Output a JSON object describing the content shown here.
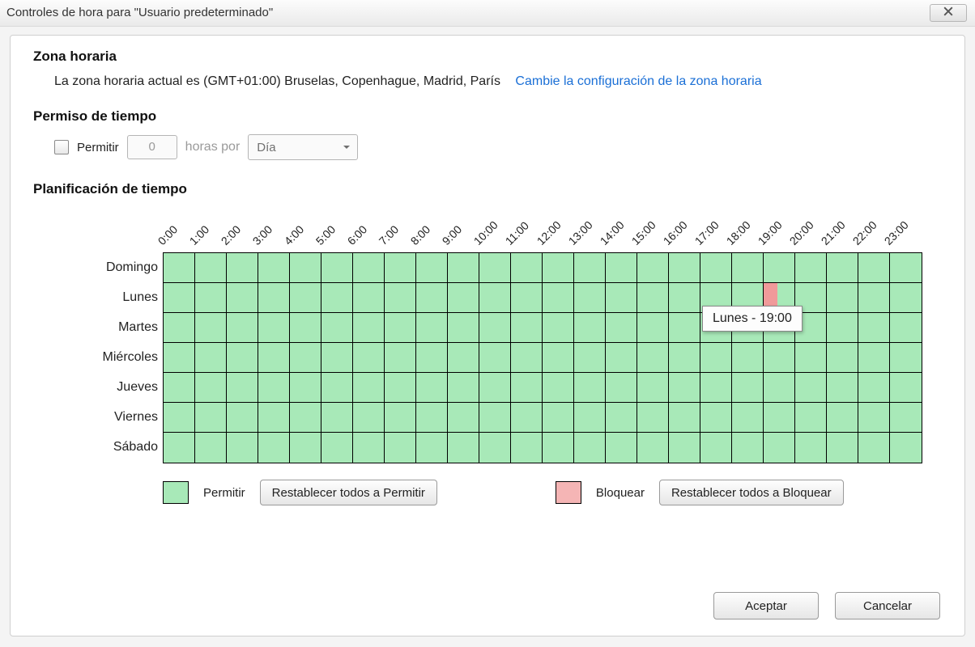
{
  "window": {
    "title": "Controles de hora para \"Usuario predeterminado\""
  },
  "sections": {
    "timezone_heading": "Zona horaria",
    "timezone_text": "La zona horaria actual es (GMT+01:00) Bruselas, Copenhague, Madrid, París",
    "timezone_link": "Cambie la configuración de la zona horaria",
    "allowance_heading": "Permiso de tiempo",
    "schedule_heading": "Planificación de tiempo"
  },
  "allowance": {
    "permit_label": "Permitir",
    "permit_checked": false,
    "hours_value": "0",
    "hours_per_label": "horas por",
    "unit_selected": "Día"
  },
  "schedule": {
    "hours": [
      "0:00",
      "1:00",
      "2:00",
      "3:00",
      "4:00",
      "5:00",
      "6:00",
      "7:00",
      "8:00",
      "9:00",
      "10:00",
      "11:00",
      "12:00",
      "13:00",
      "14:00",
      "15:00",
      "16:00",
      "17:00",
      "18:00",
      "19:00",
      "20:00",
      "21:00",
      "22:00",
      "23:00"
    ],
    "days": [
      "Domingo",
      "Lunes",
      "Martes",
      "Miércoles",
      "Jueves",
      "Viernes",
      "Sábado"
    ],
    "blocked_cells": [
      [
        1,
        19
      ]
    ],
    "tooltip": "Lunes - 19:00"
  },
  "legend": {
    "allow_label": "Permitir",
    "reset_allow_btn": "Restablecer todos a Permitir",
    "block_label": "Bloquear",
    "reset_block_btn": "Restablecer todos a Bloquear"
  },
  "footer": {
    "accept": "Aceptar",
    "cancel": "Cancelar"
  },
  "colors": {
    "allow": "#a8e9b8",
    "block": "#f5b5b5",
    "link": "#1a6fd6"
  }
}
